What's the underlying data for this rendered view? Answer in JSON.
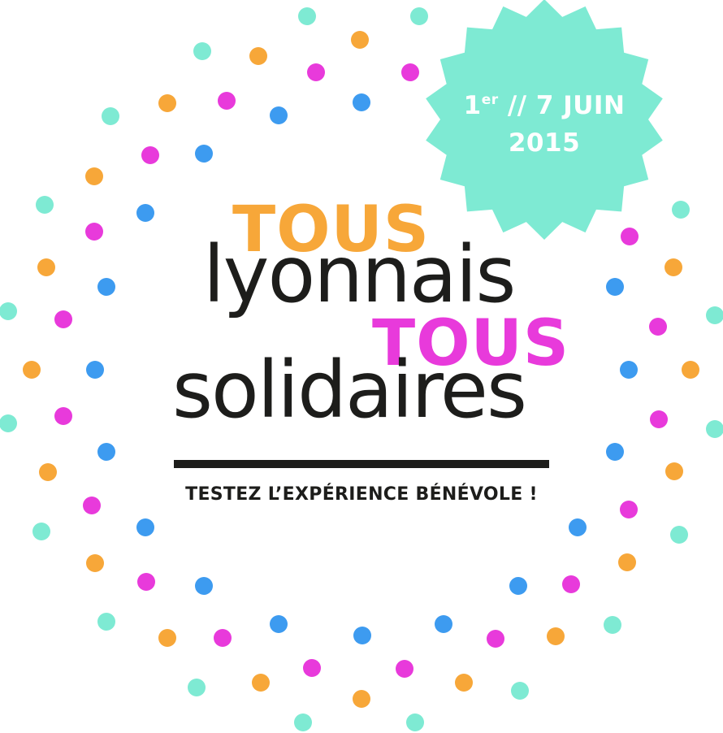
{
  "colors": {
    "teal": "#7eead3",
    "orange": "#f7a739",
    "magenta": "#e83adb",
    "blue": "#3d9bf0",
    "black": "#1d1d1b",
    "badge": "#7eead3"
  },
  "badge": {
    "day_start": "1",
    "ordinal": "er",
    "separator_and_end": "// 7 JUIN",
    "year": "2015"
  },
  "title": {
    "word1": "TOUS",
    "word2": "lyonnais",
    "word3": "TOUS",
    "word4": "solidaires"
  },
  "tagline": "TESTEZ L’EXPÉRIENCE BÉNÉVOLE !"
}
